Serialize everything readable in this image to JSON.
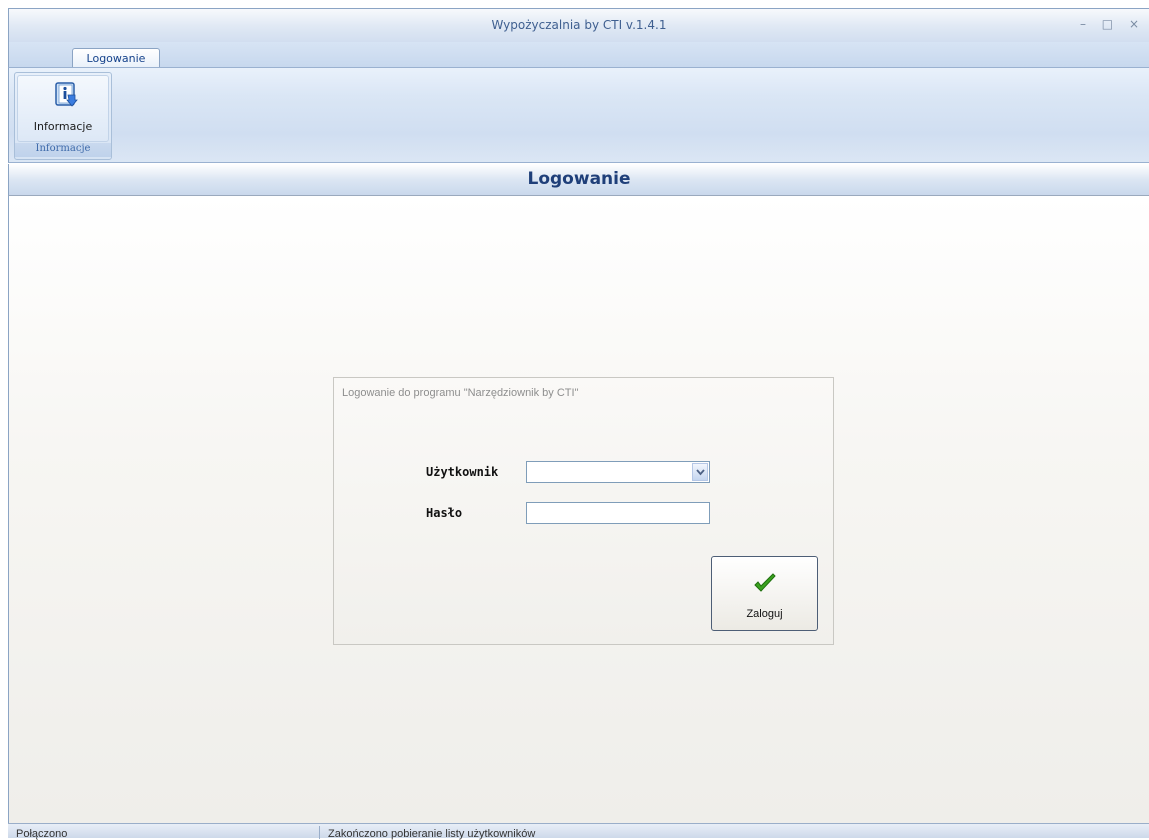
{
  "window": {
    "title": "Wypożyczalnia by CTI v.1.4.1",
    "controls": {
      "minimize": "–",
      "maximize": "□",
      "close": "×"
    }
  },
  "tabs": [
    {
      "label": "Logowanie",
      "active": true
    }
  ],
  "ribbon": {
    "groups": [
      {
        "label": "Informacje",
        "buttons": [
          {
            "label": "Informacje",
            "icon": "info-book-icon"
          }
        ]
      }
    ]
  },
  "page": {
    "title": "Logowanie"
  },
  "login": {
    "caption": "Logowanie do programu \"Narzędziownik by CTI\"",
    "user_label": "Użytkownik",
    "user_value": "",
    "password_label": "Hasło",
    "password_value": "",
    "submit_label": "Zaloguj",
    "submit_icon": "green-check-icon"
  },
  "statusbar": {
    "connection": "Połączono",
    "message": "Zakończono pobieranie listy użytkowników"
  },
  "colors": {
    "accent_text": "#1f3f79",
    "ribbon_bg": "#d0def1",
    "check_green": "#3aa21f"
  }
}
